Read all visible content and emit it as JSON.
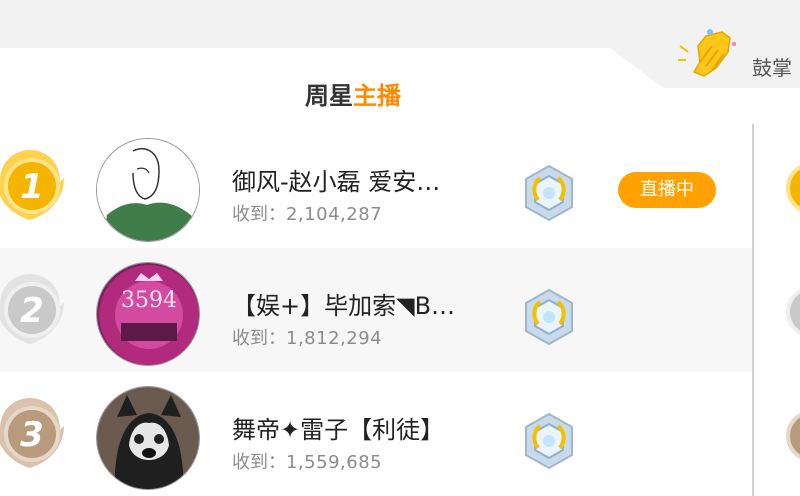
{
  "header": {
    "title_prefix": "周星",
    "title_accent": "主播",
    "clap_label": "鼓掌"
  },
  "colors": {
    "accent": "#ff8a00",
    "live_button": "#ffa200",
    "gold": "#f5b400",
    "silver": "#c9c9c9",
    "bronze": "#b79b7c"
  },
  "list": {
    "rows": [
      {
        "rank": "1",
        "name": "御风-赵小磊 爱安…",
        "received_label": "收到：",
        "amount": "2,104,287",
        "live_label": "直播中",
        "medal": "gold"
      },
      {
        "rank": "2",
        "name": "【娱+】毕加索◥B…",
        "received_label": "收到：",
        "amount": "1,812,294",
        "medal": "silver"
      },
      {
        "rank": "3",
        "name": "舞帝✦雷子【利徒】",
        "received_label": "收到：",
        "amount": "1,559,685",
        "medal": "bronze"
      }
    ]
  }
}
